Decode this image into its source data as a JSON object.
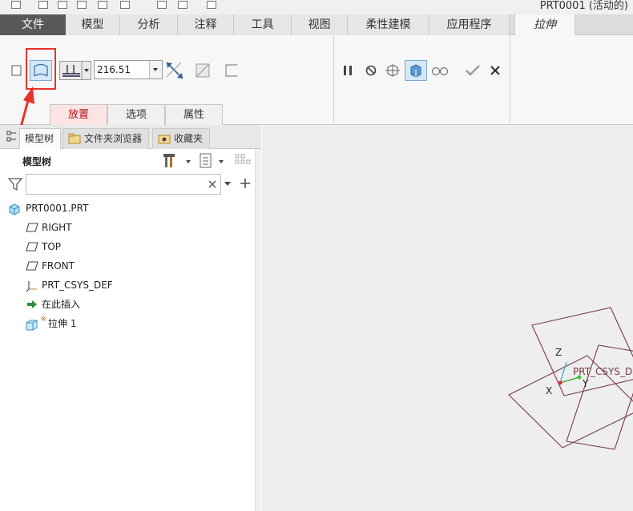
{
  "window": {
    "title": "PRT0001 (活动的)"
  },
  "tabs": [
    {
      "label": "文件"
    },
    {
      "label": "模型"
    },
    {
      "label": "分析"
    },
    {
      "label": "注释"
    },
    {
      "label": "工具"
    },
    {
      "label": "视图"
    },
    {
      "label": "柔性建模"
    },
    {
      "label": "应用程序"
    },
    {
      "label": "拉伸"
    }
  ],
  "ribbon": {
    "depth_value": "216.51",
    "sub_tabs": [
      {
        "label": "放置"
      },
      {
        "label": "选项"
      },
      {
        "label": "属性"
      }
    ],
    "highlight_color": "#e8332a"
  },
  "panel": {
    "tabs": [
      {
        "label": "模型树"
      },
      {
        "label": "文件夹浏览器"
      },
      {
        "label": "收藏夹"
      }
    ],
    "header": "模型树",
    "filter": {
      "value": "",
      "placeholder": ""
    }
  },
  "tree": [
    {
      "label": "PRT0001.PRT",
      "icon": "part-icon"
    },
    {
      "label": "RIGHT",
      "icon": "datum-plane-icon"
    },
    {
      "label": "TOP",
      "icon": "datum-plane-icon"
    },
    {
      "label": "FRONT",
      "icon": "datum-plane-icon"
    },
    {
      "label": "PRT_CSYS_DEF",
      "icon": "csys-icon"
    },
    {
      "label": "在此插入",
      "icon": "insert-arrow-icon"
    },
    {
      "label": "拉伸 1",
      "icon": "extrude-icon",
      "marker": "※"
    }
  ],
  "viewport": {
    "csys_label": "PRT_CSYS_DEF",
    "axis_x": "X",
    "axis_y": "Y",
    "axis_z": "Z"
  }
}
